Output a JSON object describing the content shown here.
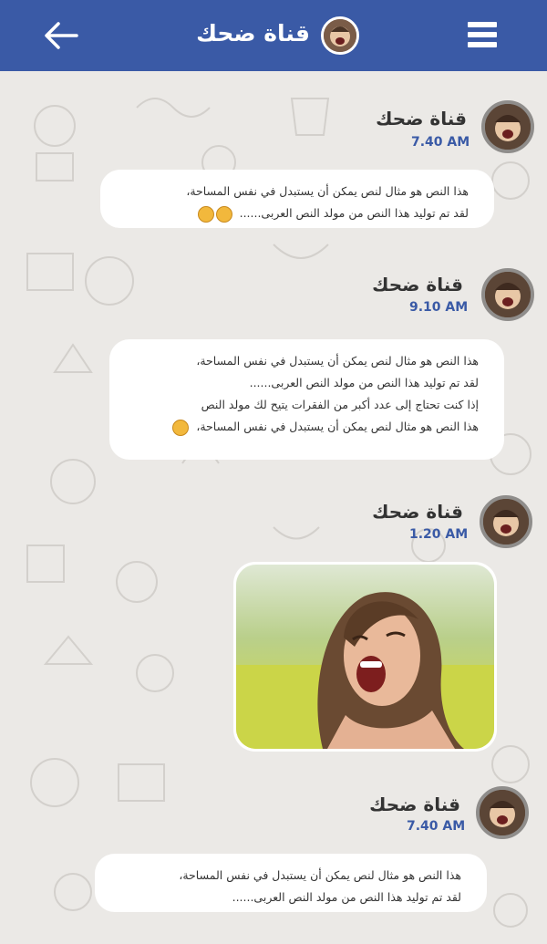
{
  "header": {
    "title": "قناة ضحك",
    "back_icon": "arrow-left-icon",
    "menu_icon": "hamburger-menu-icon",
    "color": "#3a5aa6"
  },
  "messages": [
    {
      "sender": "قناة ضحك",
      "time": "7.40 AM",
      "lines": [
        "هذا النص هو مثال لنص يمكن أن يستبدل في نفس المساحة،",
        "لقد تم توليد هذا النص من مولد النص العربى......"
      ],
      "emojis": [
        "laughing-emoji",
        "happy-emoji"
      ]
    },
    {
      "sender": "قناة ضحك",
      "time": "9.10 AM",
      "lines": [
        "هذا النص هو مثال لنص يمكن أن يستبدل في نفس المساحة،",
        "لقد تم توليد هذا النص من مولد النص العربى......",
        "إذا كنت تحتاج إلى عدد أكبر من الفقرات يتيح لك مولد النص",
        "هذا النص هو مثال لنص يمكن أن يستبدل في نفس المساحة،"
      ],
      "emojis": [
        "smile-emoji"
      ]
    },
    {
      "sender": "قناة ضحك",
      "time": "1.20 AM",
      "image": "laughing-woman-photo"
    },
    {
      "sender": "قناة ضحك",
      "time": "7.40 AM",
      "lines": [
        "هذا النص هو مثال لنص يمكن أن يستبدل في نفس المساحة،",
        "لقد تم توليد هذا النص من مولد النص العربى......"
      ]
    }
  ]
}
